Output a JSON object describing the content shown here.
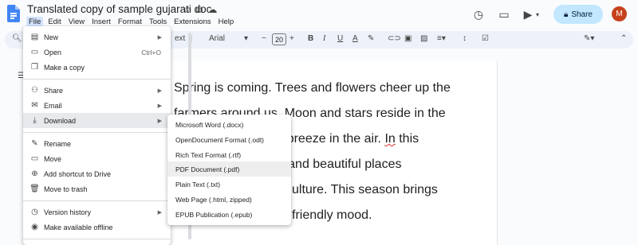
{
  "doc": {
    "title": "Translated copy of sample gujarati doc"
  },
  "menubar": {
    "items": [
      "File",
      "Edit",
      "View",
      "Insert",
      "Format",
      "Tools",
      "Extensions",
      "Help"
    ]
  },
  "header": {
    "share_label": "Share",
    "avatar_letter": "M"
  },
  "toolbar": {
    "style_partial": "ext",
    "font": "Arial",
    "font_size": "20",
    "minus": "−",
    "plus": "+"
  },
  "file_menu": {
    "items": [
      {
        "label": "New",
        "icon": "document-icon",
        "has_submenu": true
      },
      {
        "label": "Open",
        "icon": "folder-icon",
        "shortcut": "Ctrl+O"
      },
      {
        "label": "Make a copy",
        "icon": "copy-icon"
      },
      {
        "label": "Share",
        "icon": "share-icon",
        "has_submenu": true
      },
      {
        "label": "Email",
        "icon": "email-icon",
        "has_submenu": true
      },
      {
        "label": "Download",
        "icon": "download-icon",
        "has_submenu": true,
        "highlighted": true
      },
      {
        "label": "Rename",
        "icon": "rename-icon"
      },
      {
        "label": "Move",
        "icon": "move-icon"
      },
      {
        "label": "Add shortcut to Drive",
        "icon": "shortcut-icon"
      },
      {
        "label": "Move to trash",
        "icon": "trash-icon"
      },
      {
        "label": "Version history",
        "icon": "history-icon",
        "has_submenu": true
      },
      {
        "label": "Make available offline",
        "icon": "offline-icon"
      }
    ]
  },
  "download_submenu": {
    "items": [
      {
        "label": "Microsoft Word (.docx)"
      },
      {
        "label": "OpenDocument Format (.odt)"
      },
      {
        "label": "Rich Text Format (.rtf)"
      },
      {
        "label": "PDF Document (.pdf)",
        "highlighted": true
      },
      {
        "label": "Plain Text (.txt)"
      },
      {
        "label": "Web Page (.html, zipped)"
      },
      {
        "label": "EPUB Publication (.epub)"
      }
    ]
  },
  "document_lines": [
    {
      "text": "Spring is coming. Trees and flowers cheer up the"
    },
    {
      "text": "farmers around us. Moon and stars reside in the"
    },
    {
      "pre": "ght breeze in the air. ",
      "err": "In",
      "post": " this"
    },
    {
      "text": "een and beautiful places"
    },
    {
      "text": "ulture. This season brings"
    },
    {
      "text": "friendly mood."
    }
  ],
  "colors": {
    "accent": "#c2e7ff",
    "brand_blue": "#4285f4",
    "avatar": "#c5411b",
    "highlight": "#e7e9ec"
  }
}
